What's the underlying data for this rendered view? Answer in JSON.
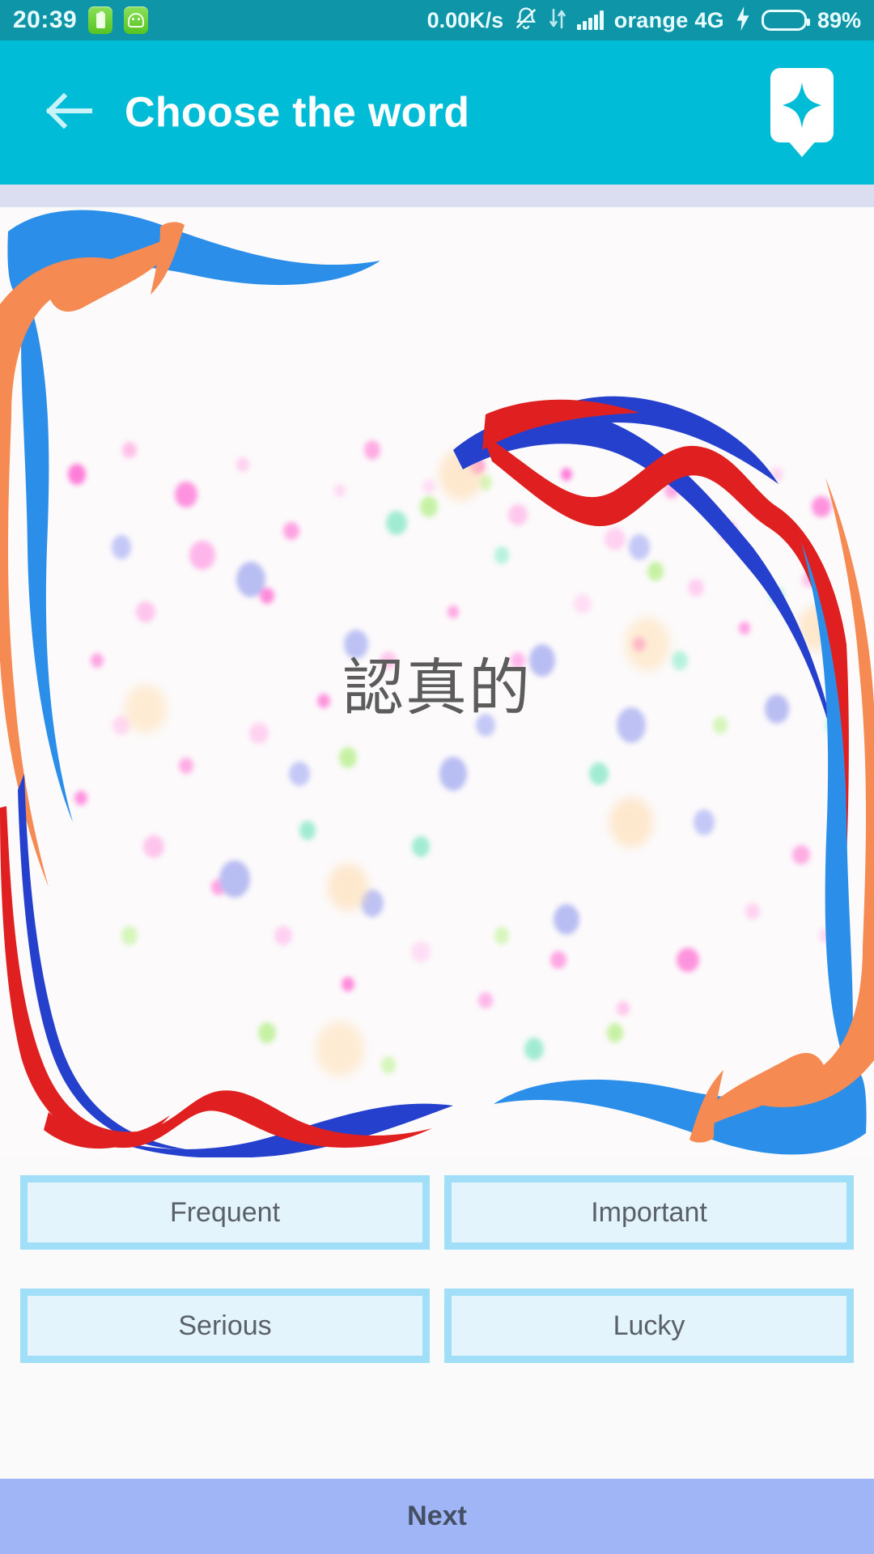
{
  "status_bar": {
    "time": "20:39",
    "network_speed": "0.00K/s",
    "carrier": "orange 4G",
    "battery_percent": "89%",
    "battery_level": 89,
    "icons": [
      "battery-saver-app-icon",
      "android-robot-app-icon",
      "bell-muted-icon",
      "data-transfer-icon",
      "signal-bars-icon",
      "charging-bolt-icon",
      "battery-icon"
    ],
    "colors": {
      "background": "#0E95A8",
      "text": "#E8FCFF",
      "battery_fill": "#4CD827"
    }
  },
  "app_bar": {
    "title": "Choose the word",
    "back_icon": "arrow-left-icon",
    "action_icon": "sparkle-badge-icon",
    "colors": {
      "background": "#00BCD7",
      "title": "#FFFFFF"
    }
  },
  "progress": {
    "value": 0,
    "track_color": "#DBDDF1",
    "fill_color": "#7E8DE8"
  },
  "card": {
    "word": "認真的",
    "word_color": "#5C5C5C",
    "background": "#FCFAFB",
    "ribbon_colors": {
      "blue": "#2196F3",
      "orange": "#F58A52",
      "red": "#E02020",
      "navy": "#2440CC"
    }
  },
  "answers": {
    "rows": [
      [
        {
          "label": "Frequent"
        },
        {
          "label": "Important"
        }
      ],
      [
        {
          "label": "Serious"
        },
        {
          "label": "Lucky"
        }
      ]
    ],
    "colors": {
      "border": "#A1DEF8",
      "fill": "#E4F4FC",
      "text": "#5A6068"
    }
  },
  "next_button": {
    "label": "Next",
    "colors": {
      "background": "#9FB5F6",
      "text": "#444F64"
    }
  }
}
